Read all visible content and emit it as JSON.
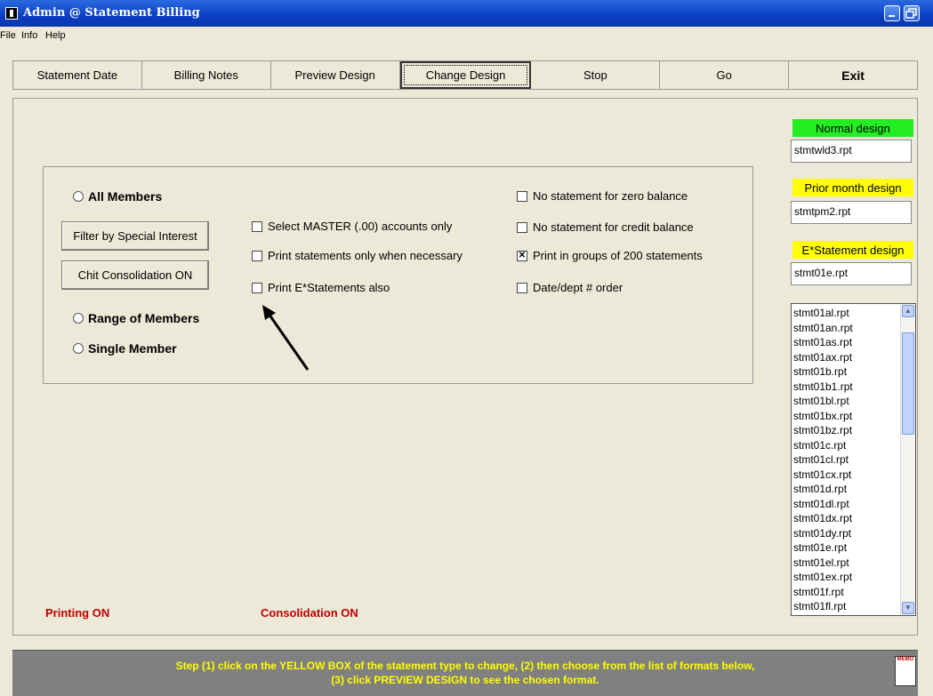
{
  "window": {
    "title": "Admin @ Statement Billing"
  },
  "menu": [
    "File",
    "Info",
    "Help"
  ],
  "toolbar": [
    "Statement Date",
    "Billing Notes",
    "Preview Design",
    "Change Design",
    "Stop",
    "Go",
    "Exit"
  ],
  "selection": {
    "all_members": "All Members",
    "range_members": "Range of Members",
    "single_member": "Single Member",
    "filter_button": "Filter by Special Interest",
    "chit_button": "Chit Consolidation ON"
  },
  "checks": {
    "master_only": "Select MASTER (.00) accounts only",
    "when_necessary": "Print statements only when necessary",
    "estatements": "Print E*Statements also",
    "zero_balance": "No statement for zero balance",
    "credit_balance": "No statement for credit balance",
    "groups_200": "Print in groups of 200 statements",
    "date_dept": "Date/dept # order",
    "groups_200_checked": true
  },
  "status": {
    "printing": "Printing ON",
    "consolidation": "Consolidation ON"
  },
  "designs": {
    "normal_label": "Normal design",
    "normal_value": "stmtwld3.rpt",
    "prior_label": "Prior month design",
    "prior_value": "stmtpm2.rpt",
    "estatement_label": "E*Statement design",
    "estatement_value": "stmt01e.rpt",
    "colors": {
      "normal": "#22ee22",
      "prior": "#ffff00",
      "estatement": "#ffff00"
    }
  },
  "format_list": [
    "stmt01al.rpt",
    "stmt01an.rpt",
    "stmt01as.rpt",
    "stmt01ax.rpt",
    "stmt01b.rpt",
    "stmt01b1.rpt",
    "stmt01bl.rpt",
    "stmt01bx.rpt",
    "stmt01bz.rpt",
    "stmt01c.rpt",
    "stmt01cl.rpt",
    "stmt01cx.rpt",
    "stmt01d.rpt",
    "stmt01dl.rpt",
    "stmt01dx.rpt",
    "stmt01dy.rpt",
    "stmt01e.rpt",
    "stmt01el.rpt",
    "stmt01ex.rpt",
    "stmt01f.rpt",
    "stmt01fl.rpt"
  ],
  "footer": {
    "line1": "Step (1) click on the YELLOW BOX of the statement type to change, (2) then choose from the list of formats below,",
    "line2": "(3) click PREVIEW DESIGN to see the chosen format.",
    "memo": "MEMO"
  }
}
